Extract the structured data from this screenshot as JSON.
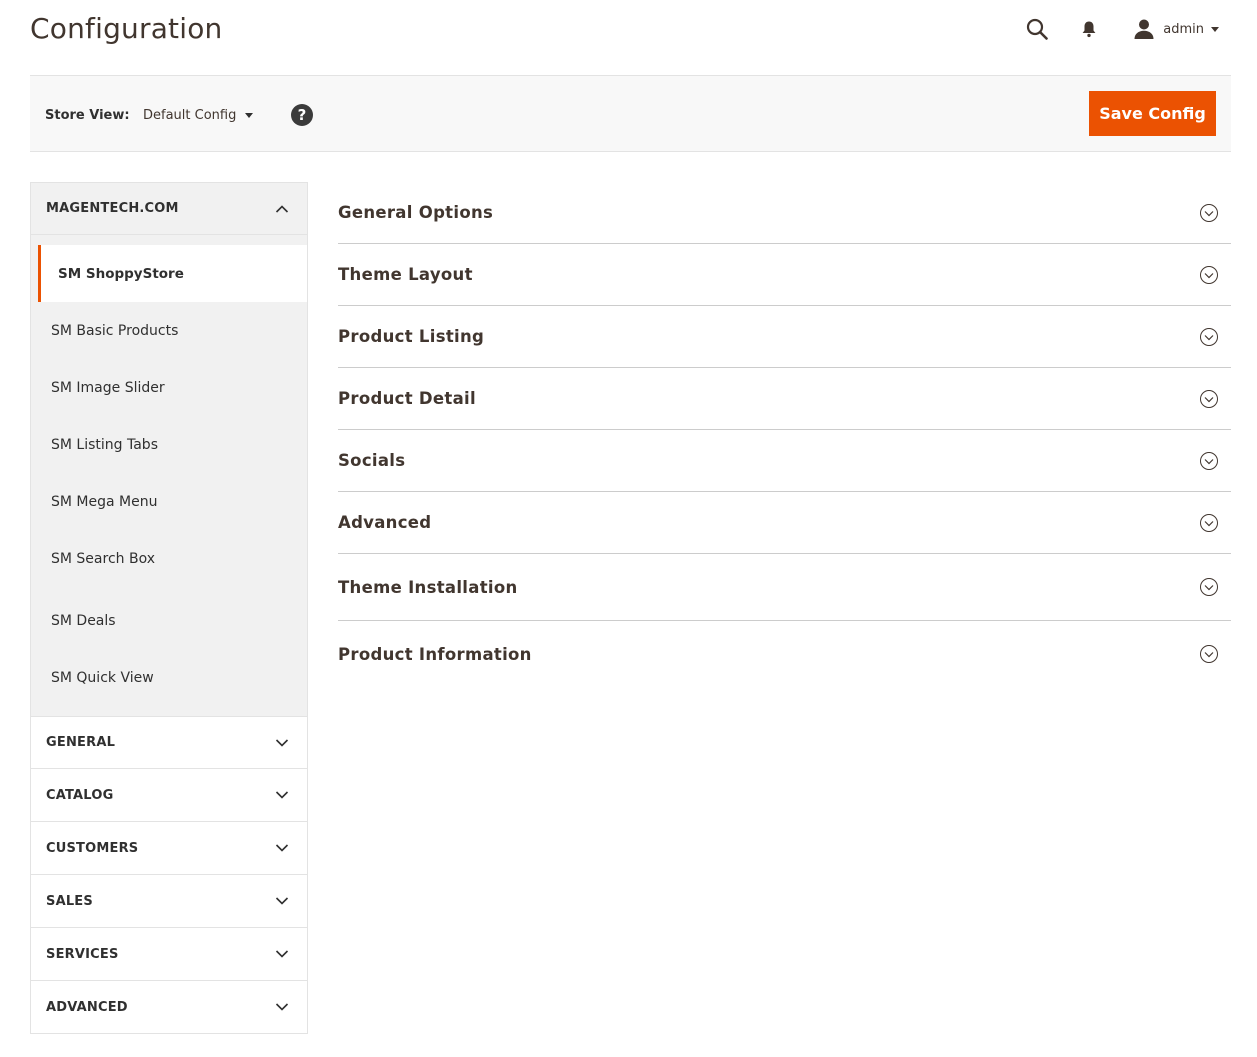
{
  "header": {
    "title": "Configuration",
    "user": "admin",
    "icons": [
      "search-icon",
      "bell-icon",
      "user-icon"
    ]
  },
  "store_bar": {
    "label": "Store View:",
    "selected": "Default Config",
    "help": "?",
    "save_label": "Save Config"
  },
  "sidebar": {
    "open_tab": {
      "label": "MAGENTECH.COM",
      "items": [
        {
          "label": "SM ShoppyStore",
          "active": true
        },
        {
          "label": "SM Basic Products"
        },
        {
          "label": "SM Image Slider"
        },
        {
          "label": "SM Listing Tabs"
        },
        {
          "label": "SM Mega Menu"
        },
        {
          "label": "SM Search Box"
        },
        {
          "label": "SM Deals"
        },
        {
          "label": "SM Quick View"
        }
      ]
    },
    "collapsed_tabs": [
      "GENERAL",
      "CATALOG",
      "CUSTOMERS",
      "SALES",
      "SERVICES",
      "ADVANCED"
    ]
  },
  "sections": [
    "General Options",
    "Theme Layout",
    "Product Listing",
    "Product Detail",
    "Socials",
    "Advanced",
    "Theme Installation",
    "Product Information"
  ],
  "colors": {
    "accent": "#eb5202",
    "panel": "#f1f1f1",
    "text": "#303030"
  }
}
